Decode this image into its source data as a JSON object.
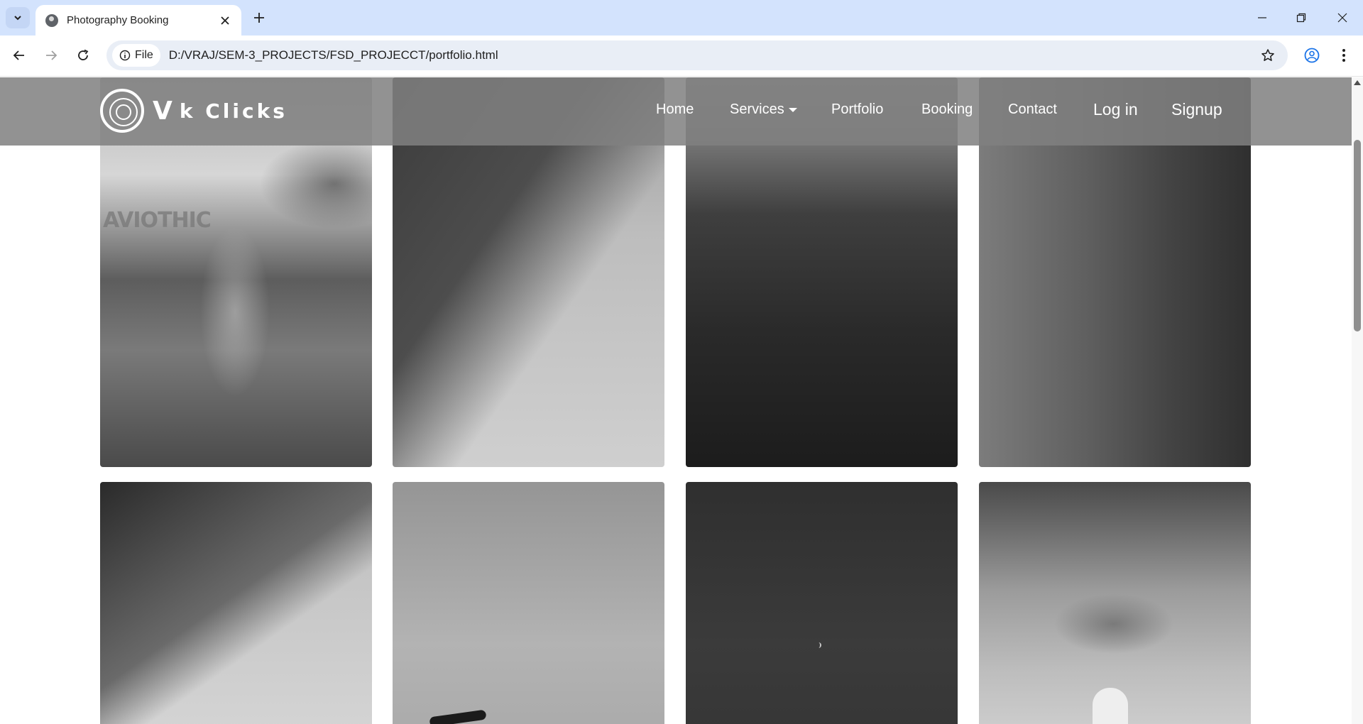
{
  "browser": {
    "tab_title": "Photography Booking",
    "url_chip": "File",
    "url": "D:/VRAJ/SEM-3_PROJECTS/FSD_PROJECCT/portfolio.html"
  },
  "site": {
    "logo_v": "V",
    "logo_rest": "k Clicks",
    "nav": {
      "home": "Home",
      "services": "Services",
      "portfolio": "Portfolio",
      "booking": "Booking",
      "contact": "Contact",
      "login": "Log in",
      "signup": "Signup"
    }
  },
  "gallery": {
    "watermark": "AVIOTHIC"
  },
  "icons": {
    "tab_search": "chevron-down-icon",
    "favicon": "globe-icon",
    "tab_close": "close-icon",
    "new_tab": "plus-icon",
    "back": "arrow-left-icon",
    "forward": "arrow-right-icon",
    "reload": "reload-icon",
    "info": "info-icon",
    "bookmark": "star-icon",
    "profile": "profile-icon",
    "menu": "kebab-menu-icon"
  }
}
